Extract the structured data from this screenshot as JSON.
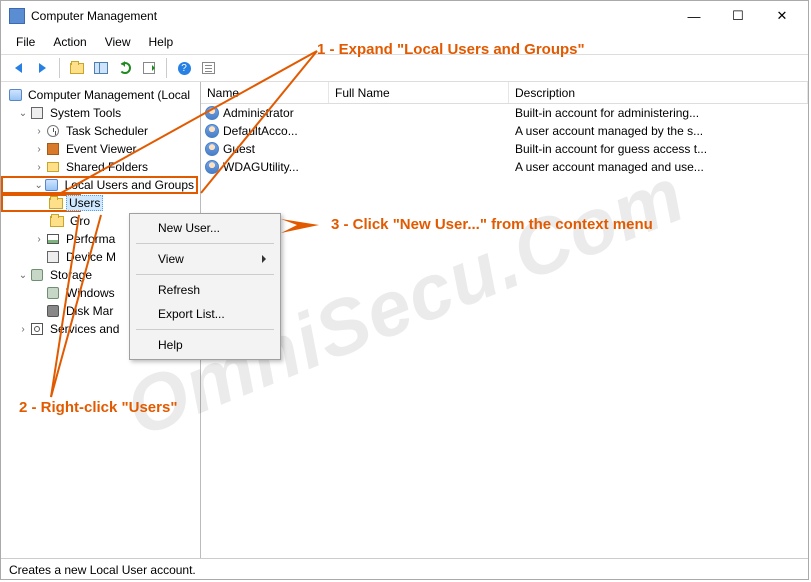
{
  "window": {
    "title": "Computer Management",
    "controls": {
      "min": "—",
      "max": "☐",
      "close": "✕"
    }
  },
  "menubar": [
    "File",
    "Action",
    "View",
    "Help"
  ],
  "toolbar_items": [
    {
      "id": "back-button",
      "icon": "arrow-left"
    },
    {
      "id": "forward-button",
      "icon": "arrow-right"
    },
    {
      "sep": true
    },
    {
      "id": "up-folder-button",
      "icon": "icon-folder"
    },
    {
      "id": "show-tree-button",
      "icon": "icon-pane"
    },
    {
      "id": "refresh-button",
      "icon": "icon-refresh"
    },
    {
      "id": "export-list-button",
      "icon": "icon-export"
    },
    {
      "sep": true
    },
    {
      "id": "help-button",
      "icon": "icon-help",
      "glyph": "?"
    },
    {
      "id": "properties-button",
      "icon": "icon-prop"
    }
  ],
  "tree": {
    "root": "Computer Management (Local",
    "system_tools": {
      "label": "System Tools",
      "children": [
        {
          "id": "task-scheduler",
          "label": "Task Scheduler",
          "icon": "icon-clock"
        },
        {
          "id": "event-viewer",
          "label": "Event Viewer",
          "icon": "icon-book"
        },
        {
          "id": "shared-folders",
          "label": "Shared Folders",
          "icon": "icon-share"
        },
        {
          "id": "local-users-groups",
          "label": "Local Users and Groups",
          "icon": "icon-users-grp",
          "expanded": true,
          "children": [
            {
              "id": "users-node",
              "label": "Users",
              "icon": "icon-folder"
            },
            {
              "id": "groups-node",
              "label": "Gro",
              "icon": "icon-folder"
            }
          ]
        },
        {
          "id": "performance",
          "label": "Performa",
          "icon": "icon-perf"
        },
        {
          "id": "device-manager",
          "label": "Device M",
          "icon": "icon-dev"
        }
      ]
    },
    "storage": {
      "label": "Storage",
      "children": [
        {
          "id": "windows-server",
          "label": "Windows",
          "icon": "icon-store"
        },
        {
          "id": "disk-management",
          "label": "Disk Mar",
          "icon": "icon-disk"
        }
      ]
    },
    "services": {
      "label": "Services and",
      "icon": "icon-svc"
    }
  },
  "list": {
    "columns": {
      "name": "Name",
      "full": "Full Name",
      "desc": "Description"
    },
    "rows": [
      {
        "name": "Administrator",
        "full": "",
        "desc": "Built-in account for administering..."
      },
      {
        "name": "DefaultAcco...",
        "full": "",
        "desc": "A user account managed by the s..."
      },
      {
        "name": "Guest",
        "full": "",
        "desc": "Built-in account for guess access t..."
      },
      {
        "name": "WDAGUtility...",
        "full": "",
        "desc": "A user account managed and use..."
      }
    ]
  },
  "context_menu": {
    "new_user": "New User...",
    "view": "View",
    "refresh": "Refresh",
    "export": "Export List...",
    "help": "Help"
  },
  "statusbar": "Creates a new Local User account.",
  "annotations": {
    "step1": "1 - Expand \"Local Users and Groups\"",
    "step2": "2 - Right-click \"Users\"",
    "step3": "3 - Click \"New User...\" from the context menu"
  },
  "watermark": "OmniSecu.Com"
}
